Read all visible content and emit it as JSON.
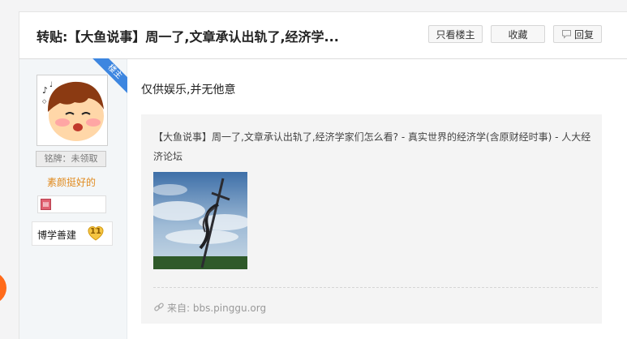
{
  "post": {
    "title": "转贴:【大鱼说事】周一了,文章承认出轨了,经济学...",
    "body_text": "仅供娱乐,并无他意"
  },
  "header_buttons": {
    "only_author": "只看楼主",
    "favorite": "收藏",
    "reply": "回复"
  },
  "author": {
    "ribbon": "楼主",
    "medal": "铭牌：未领取",
    "signature": "素颜挺好的",
    "level_name": "博学善建",
    "level_number": "11"
  },
  "quote": {
    "title": "【大鱼说事】周一了,文章承认出轨了,经济学家们怎么看? - 真实世界的经济学(含原财经时事) - 人大经济论坛",
    "source_label": "来自:",
    "source_domain": "bbs.pinggu.org"
  },
  "colors": {
    "ribbon_blue": "#3d86e0",
    "signature_orange": "#e08a1e",
    "level_badge_gold": "#f5c542",
    "accent_orange": "#ff6a1a"
  },
  "icons": {
    "reply": "speech-bubble-icon",
    "source": "link-chain-icon",
    "rank": "rank-icon",
    "level": "heart-badge-icon"
  }
}
